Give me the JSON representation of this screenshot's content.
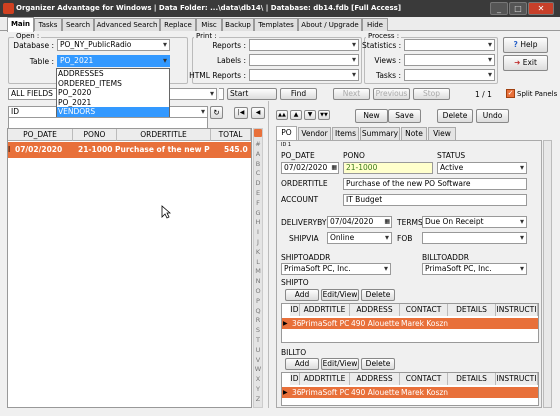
{
  "window": {
    "title": "Organizer Advantage for Windows | Data Folder: ...\\data\\db14\\ | Database: db14.fdb [Full Access]",
    "minimize": "_",
    "maximize": "□",
    "close": "✕"
  },
  "tabs": [
    "Main",
    "Tasks",
    "Search",
    "Advanced Search",
    "Replace",
    "Misc",
    "Backup",
    "Templates",
    "About / Upgrade",
    "Hide"
  ],
  "open_group": {
    "label": "Open :",
    "database_label": "Database :",
    "database_value": "PO_NY_PublicRadio",
    "table_label": "Table :",
    "table_value": "PO_2021",
    "table_options": [
      "ADDRESSES",
      "ORDERED_ITEMS",
      "PO_2020",
      "PO_2021",
      "VENDORS"
    ],
    "highlighted_option": "VENDORS"
  },
  "print_group": {
    "label": "Print :",
    "reports_label": "Reports :",
    "labels_label": "Labels :",
    "html_reports_label": "HTML Reports :"
  },
  "process_group": {
    "label": "Process :",
    "statistics_label": "Statistics :",
    "views_label": "Views :",
    "tasks_label": "Tasks :"
  },
  "help_button": "Help",
  "exit_button": "Exit",
  "search_bar": {
    "field": "ALL FIELDS",
    "find": "Find",
    "start": "Start",
    "next": "Next",
    "previous": "Previous",
    "stop": "Stop",
    "count": "1 / 1",
    "split_panels": "Split Panels"
  },
  "sort": {
    "field": "ID",
    "nav_first": "|◀",
    "nav_prev": "◀"
  },
  "grid": {
    "columns": [
      "PO_DATE",
      "PONO",
      "ORDERTITLE",
      "TOTAL"
    ],
    "rows": [
      {
        "marker": "I",
        "po_date": "07/02/2020",
        "pono": "21-1000",
        "ordertitle": "Purchase of the new PO",
        "total": "545.0"
      }
    ]
  },
  "alphabet": [
    "#",
    "A",
    "B",
    "C",
    "D",
    "E",
    "F",
    "G",
    "H",
    "I",
    "J",
    "K",
    "L",
    "M",
    "N",
    "O",
    "P",
    "Q",
    "R",
    "S",
    "T",
    "U",
    "V",
    "W",
    "X",
    "Y",
    "Z"
  ],
  "record_toolbar": {
    "new": "New",
    "save": "Save",
    "delete": "Delete",
    "undo": "Undo"
  },
  "form_tabs": [
    "PO",
    "Vendor",
    "Items",
    "Summary",
    "Note",
    "View"
  ],
  "form": {
    "id_label": "ID",
    "id_value": "1",
    "po_date_label": "PO_DATE",
    "po_date": "07/02/2020",
    "pono_label": "PONO",
    "pono": "21-1000",
    "status_label": "STATUS",
    "status": "Active",
    "ordertitle_label": "ORDERTITLE",
    "ordertitle": "Purchase of the new PO Software",
    "account_label": "ACCOUNT",
    "account": "IT Budget",
    "deliveryby_label": "DELIVERYBY",
    "deliveryby": "07/04/2020",
    "terms_label": "TERMS",
    "terms": "Due On Receipt",
    "shipvia_label": "SHIPVIA",
    "shipvia": "Online",
    "fob_label": "FOB",
    "fob": "",
    "shiptoaddr_label": "SHIPTOADDR",
    "shiptoaddr": "PrimaSoft PC, Inc.",
    "billtoaddr_label": "BILLTOADDR",
    "billtoaddr": "PrimaSoft PC, Inc.",
    "shipto_label": "SHIPTO",
    "billto_label": "BILLTO"
  },
  "subgrid_buttons": {
    "add": "Add",
    "edit": "Edit/View",
    "delete": "Delete"
  },
  "subgrid": {
    "columns": [
      "ID",
      "ADDRTITLE",
      "ADDRESS",
      "CONTACT",
      "DETAILS",
      "INSTRUCTI"
    ],
    "row": {
      "id": "36",
      "addrtitle": "PrimaSoft PC",
      "address": "490 Alouette",
      "contact": "Marek Koszni",
      "details": "",
      "instructions": ""
    }
  },
  "colors": {
    "accent": "#e8703a",
    "row_text": "#ffffff",
    "title_bg": "#3a3a3a",
    "highlight": "#3399ff"
  }
}
